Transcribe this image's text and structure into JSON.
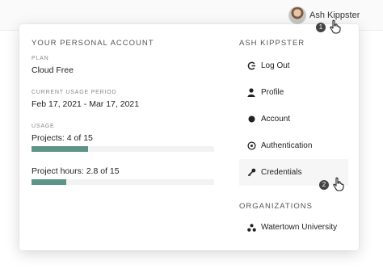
{
  "header": {
    "user_name": "Ash Kippster",
    "step_marker_1": "1"
  },
  "account": {
    "section_title": "YOUR PERSONAL ACCOUNT",
    "plan_label": "PLAN",
    "plan_value": "Cloud Free",
    "period_label": "CURRENT USAGE PERIOD",
    "period_value": "Feb 17, 2021 - Mar 17, 2021",
    "usage_label": "USAGE",
    "projects_text": "Projects: 4 of 15",
    "projects_fraction": 0.31,
    "hours_text": "Project hours: 2.8 of 15",
    "hours_fraction": 0.19,
    "bar_color": "#5e9387"
  },
  "user_menu": {
    "section_title": "ASH KIPPSTER",
    "items": [
      {
        "label": "Log Out",
        "icon": "logout-icon"
      },
      {
        "label": "Profile",
        "icon": "person-icon"
      },
      {
        "label": "Account",
        "icon": "dot-icon"
      },
      {
        "label": "Authentication",
        "icon": "target-icon"
      },
      {
        "label": "Credentials",
        "icon": "key-icon"
      }
    ],
    "step_marker_2": "2"
  },
  "organizations": {
    "section_title": "ORGANIZATIONS",
    "items": [
      {
        "label": "Watertown University",
        "icon": "organization-icon"
      }
    ]
  }
}
